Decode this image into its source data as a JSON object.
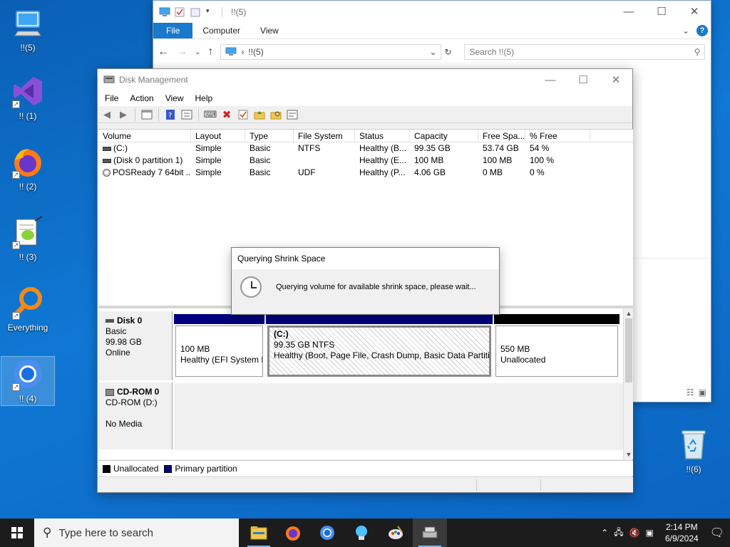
{
  "desktop": {
    "icons": [
      {
        "label": "!!(5)"
      },
      {
        "label": "!! (1)"
      },
      {
        "label": "!! (2)"
      },
      {
        "label": "!! (3)"
      },
      {
        "label": "Everything"
      },
      {
        "label": "!! (4)"
      }
    ],
    "recycle_bin": {
      "label": "!!(6)"
    }
  },
  "explorer": {
    "title": "!!(5)",
    "tabs": [
      "File",
      "Computer",
      "View"
    ],
    "address": "!!(5)",
    "search_placeholder": "Search !!(5)"
  },
  "disk_management": {
    "title": "Disk Management",
    "menu": [
      "File",
      "Action",
      "View",
      "Help"
    ],
    "columns": [
      "Volume",
      "Layout",
      "Type",
      "File System",
      "Status",
      "Capacity",
      "Free Spa...",
      "% Free"
    ],
    "rows": [
      {
        "volume": "(C:)",
        "layout": "Simple",
        "type": "Basic",
        "fs": "NTFS",
        "status": "Healthy (B...",
        "capacity": "99.35 GB",
        "free": "53.74 GB",
        "pct": "54 %"
      },
      {
        "volume": "(Disk 0 partition 1)",
        "layout": "Simple",
        "type": "Basic",
        "fs": "",
        "status": "Healthy (E...",
        "capacity": "100 MB",
        "free": "100 MB",
        "pct": "100 %"
      },
      {
        "volume": "POSReady 7 64bit ...",
        "layout": "Simple",
        "type": "Basic",
        "fs": "UDF",
        "status": "Healthy (P...",
        "capacity": "4.06 GB",
        "free": "0 MB",
        "pct": "0 %"
      }
    ],
    "disk0": {
      "name": "Disk 0",
      "type": "Basic",
      "size": "99.98 GB",
      "state": "Online",
      "partitions": [
        {
          "line1": "100 MB",
          "line2": "Healthy (EFI System P"
        },
        {
          "title": "(C:)",
          "line1": "99.35 GB NTFS",
          "line2": "Healthy (Boot, Page File, Crash Dump, Basic Data Partition"
        },
        {
          "line1": "550 MB",
          "line2": "Unallocated"
        }
      ]
    },
    "cdrom0": {
      "name": "CD-ROM 0",
      "drive": "CD-ROM (D:)",
      "media": "No Media"
    },
    "legend": [
      "Unallocated",
      "Primary partition"
    ],
    "colors": {
      "primary": "#000080",
      "unallocated": "#000000"
    }
  },
  "dialog": {
    "title": "Querying Shrink Space",
    "message": "Querying volume for available shrink space, please wait..."
  },
  "taskbar": {
    "search_placeholder": "Type here to search",
    "time": "2:14 PM",
    "date": "6/9/2024"
  }
}
